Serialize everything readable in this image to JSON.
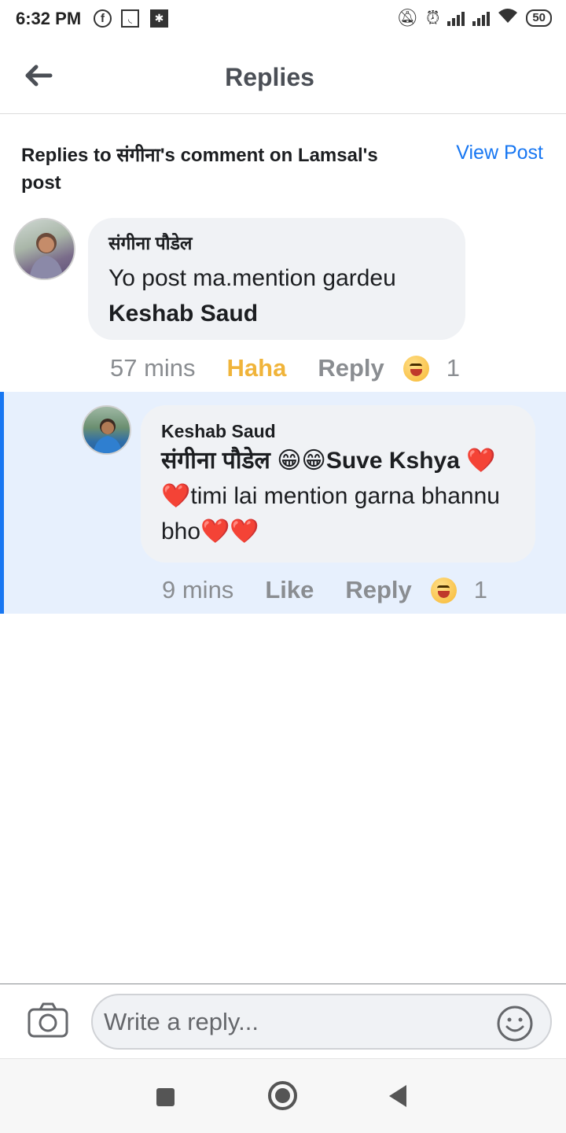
{
  "status_bar": {
    "time": "6:32 PM",
    "battery": "50",
    "icons": [
      "facebook-icon",
      "notification-box-icon",
      "notification-box2-icon",
      "mute-bell-icon",
      "alarm-icon",
      "signal-icon",
      "signal-icon",
      "wifi-icon",
      "battery-icon"
    ]
  },
  "header": {
    "title": "Replies",
    "back_icon": "arrow-left-icon"
  },
  "context": {
    "text": "Replies to संगीना's comment on Lamsal's post",
    "view_post_label": "View Post"
  },
  "comments": [
    {
      "author": "संगीना पौडेल",
      "text": "Yo post ma.mention gardeu",
      "mention": "Keshab Saud",
      "time": "57 mins",
      "reaction_label": "Haha",
      "reply_label": "Reply",
      "reaction_icon": "haha-emoji-icon",
      "reaction_count": "1"
    }
  ],
  "replies": [
    {
      "author": "Keshab Saud",
      "mention": "संगीना पौडेल",
      "emoji_grin": "😁😁",
      "mention2": "Suve Kshya",
      "hearts1": "❤️❤️",
      "text": "timi lai mention garna bhannu bho",
      "hearts2": "❤️❤️",
      "time": "9 mins",
      "like_label": "Like",
      "reply_label": "Reply",
      "reaction_icon": "haha-emoji-icon",
      "reaction_count": "1"
    }
  ],
  "composer": {
    "placeholder": "Write a reply...",
    "camera_icon": "camera-icon",
    "emoji_icon": "smiley-icon"
  },
  "nav_bar": {
    "icons": [
      "recents-square-icon",
      "home-circle-icon",
      "back-triangle-icon"
    ]
  },
  "colors": {
    "accent": "#1877f2",
    "haha": "#f0b43a",
    "bubble": "#f0f2f5",
    "highlight": "#e7f0fd"
  }
}
